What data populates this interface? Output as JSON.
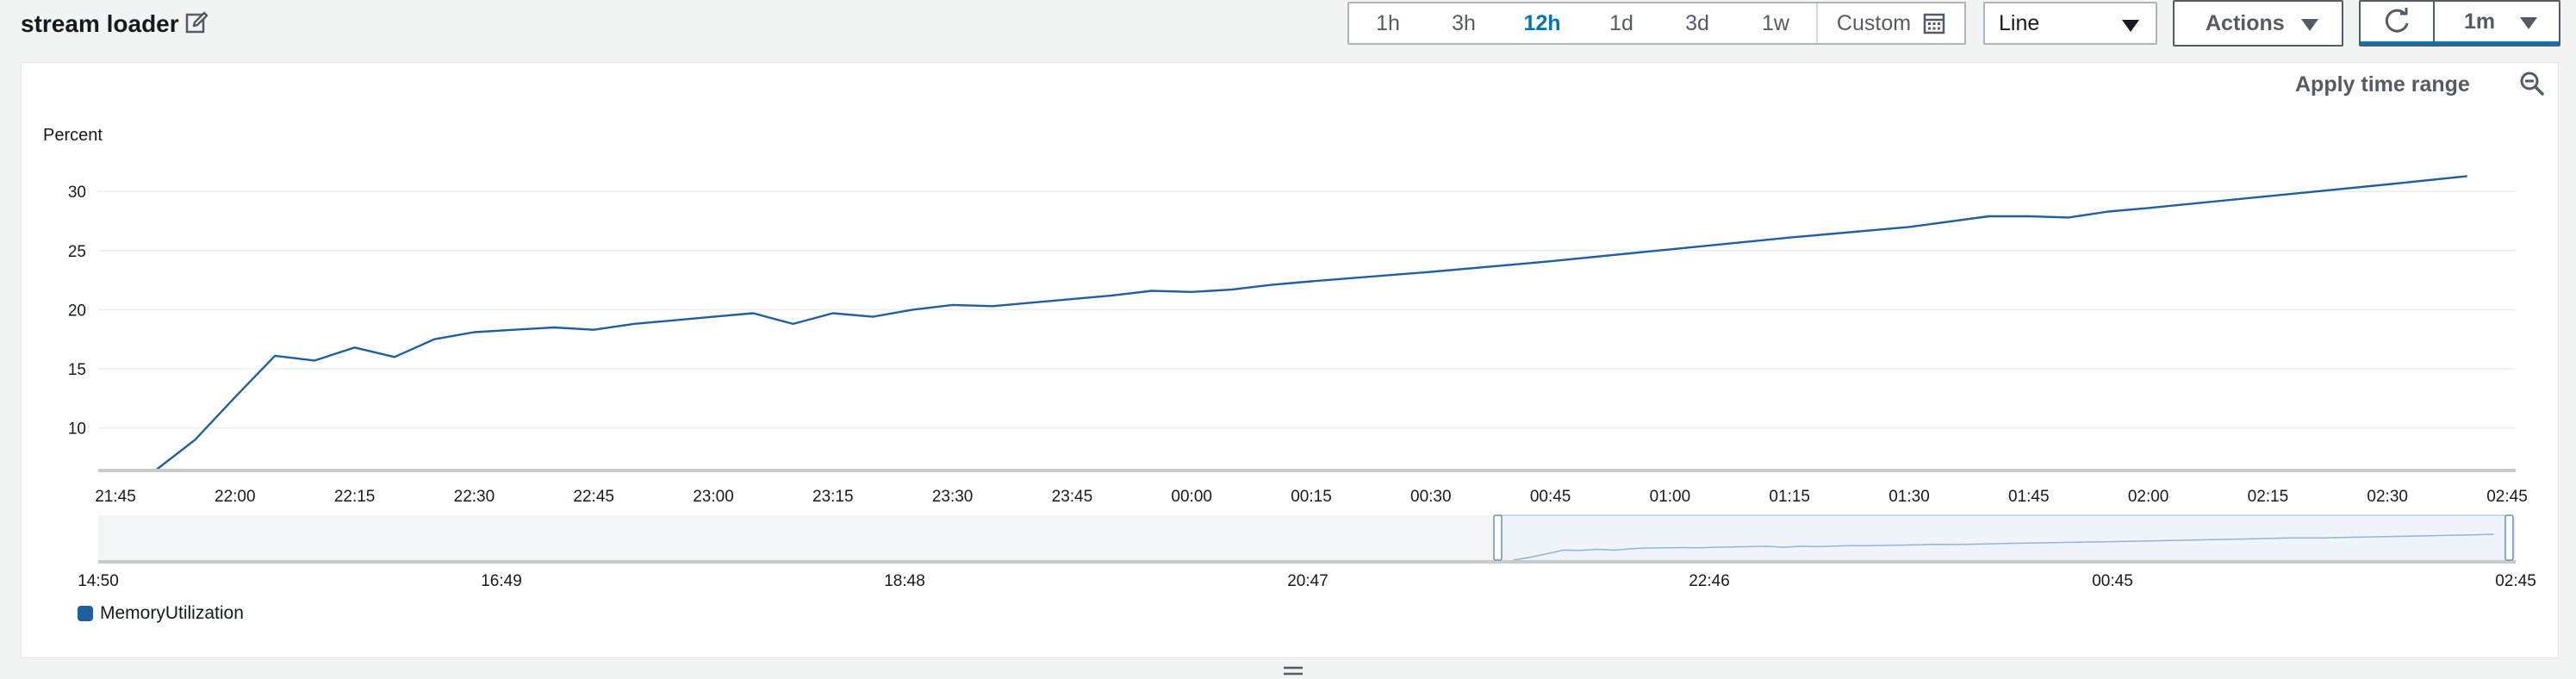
{
  "widget": {
    "title": "stream loader"
  },
  "time_ranges": [
    "1h",
    "3h",
    "12h",
    "1d",
    "3d",
    "1w"
  ],
  "active_range": "12h",
  "custom_label": "Custom",
  "chart_type_select": "Line",
  "actions_label": "Actions",
  "refresh_interval": "1m",
  "apply_time_range_label": "Apply time range",
  "icons": {
    "edit": "edit-icon",
    "calendar": "calendar-icon",
    "refresh": "refresh-icon",
    "zoom_out": "zoom-out-icon"
  },
  "colors": {
    "series": "#1f5fa0",
    "active_range": "#0073bb"
  },
  "chart_data": {
    "type": "line",
    "ylabel": "Percent",
    "yticks": [
      10,
      15,
      20,
      25,
      30
    ],
    "ylim": [
      6.4,
      33
    ],
    "xticks": [
      "21:45",
      "22:00",
      "22:15",
      "22:30",
      "22:45",
      "23:00",
      "23:15",
      "23:30",
      "23:45",
      "00:00",
      "00:15",
      "00:30",
      "00:45",
      "01:00",
      "01:15",
      "01:30",
      "01:45",
      "02:00",
      "02:15",
      "02:30",
      "02:45"
    ],
    "grid": true,
    "legend": "bottom-left",
    "series": [
      {
        "name": "MemoryUtilization",
        "x": [
          "21:50",
          "21:55",
          "22:00",
          "22:05",
          "22:10",
          "22:15",
          "22:20",
          "22:25",
          "22:30",
          "22:35",
          "22:40",
          "22:45",
          "22:50",
          "22:55",
          "23:00",
          "23:05",
          "23:10",
          "23:15",
          "23:20",
          "23:25",
          "23:30",
          "23:35",
          "23:40",
          "23:45",
          "23:50",
          "23:55",
          "00:00",
          "00:05",
          "00:10",
          "00:15",
          "00:30",
          "00:45",
          "01:00",
          "01:15",
          "01:30",
          "01:40",
          "01:45",
          "01:50",
          "01:55",
          "02:00",
          "02:15",
          "02:30",
          "02:40"
        ],
        "values": [
          6.4,
          9,
          12.6,
          16.1,
          15.7,
          16.8,
          16,
          17.5,
          18.1,
          18.3,
          18.5,
          18.3,
          18.8,
          19.1,
          19.4,
          19.7,
          18.8,
          19.7,
          19.4,
          20,
          20.4,
          20.3,
          20.6,
          20.9,
          21.2,
          21.6,
          21.5,
          21.7,
          22.1,
          22.4,
          23.2,
          24.1,
          25.1,
          26.1,
          27,
          27.9,
          27.9,
          27.8,
          28.3,
          28.6,
          29.6,
          30.6,
          31.3
        ]
      }
    ],
    "navigator": {
      "xticks": [
        "14:50",
        "16:49",
        "18:48",
        "20:47",
        "22:46",
        "00:45",
        "02:45"
      ]
    }
  },
  "legend_items": [
    "MemoryUtilization"
  ]
}
